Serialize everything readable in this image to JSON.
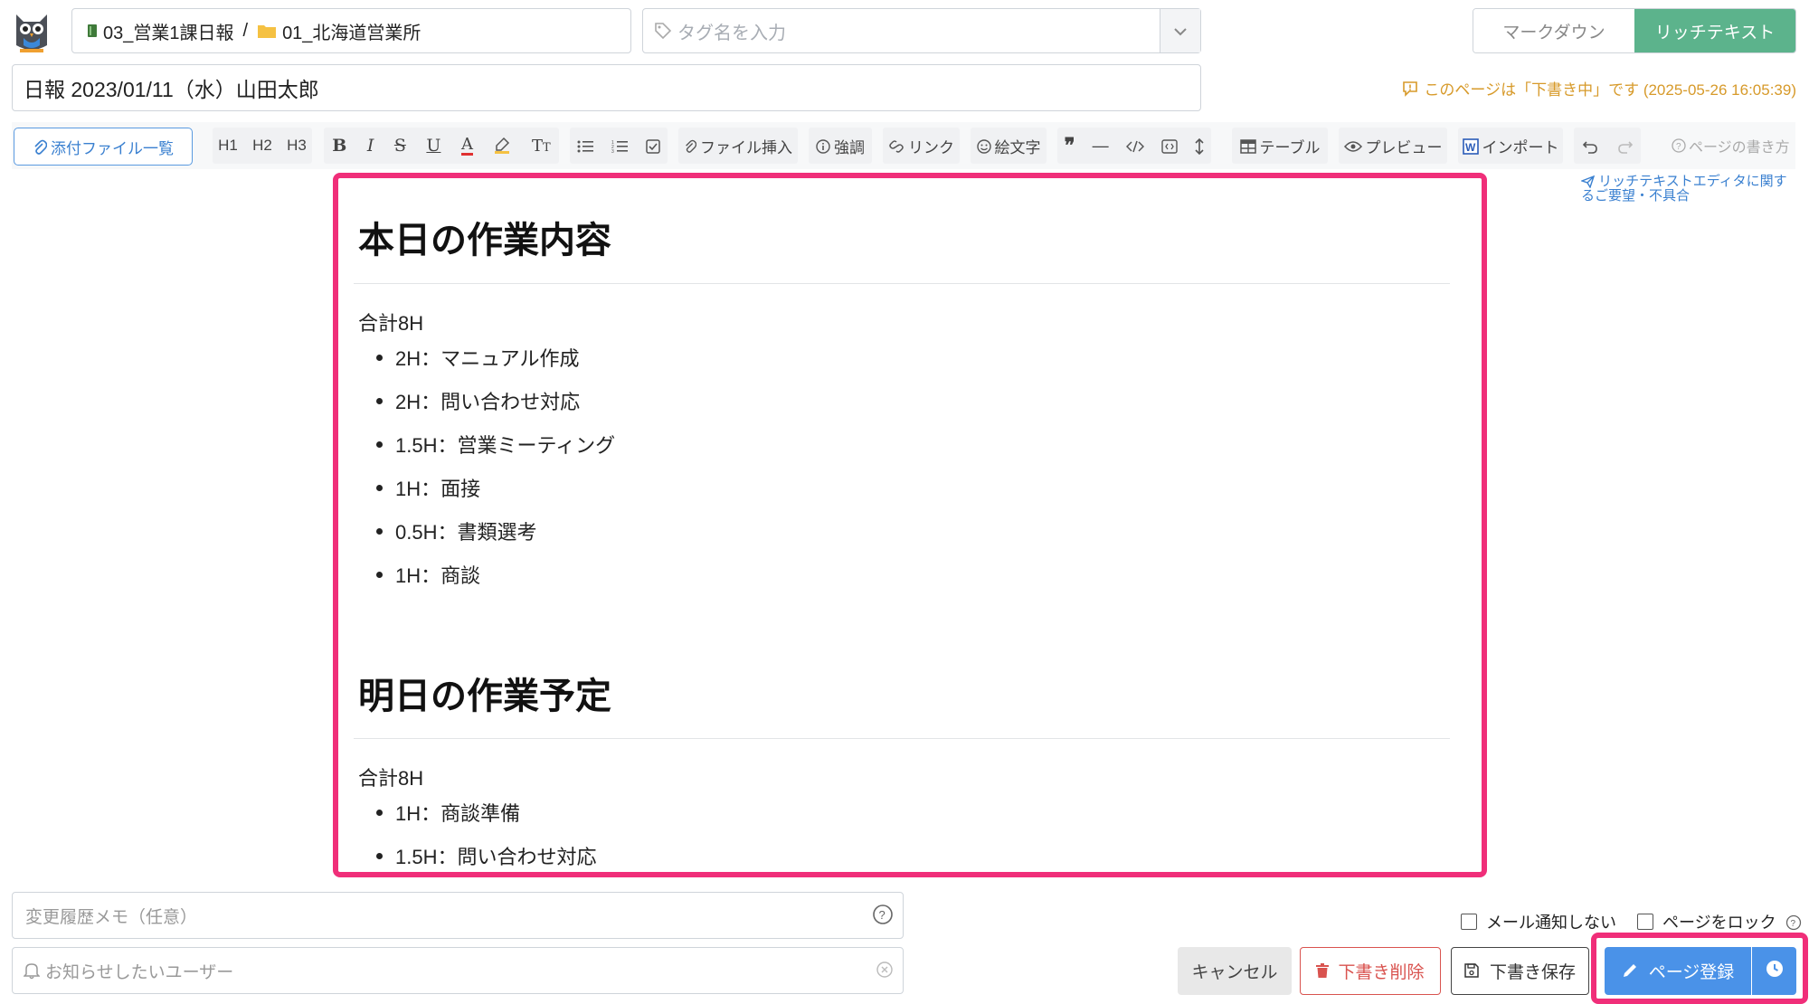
{
  "header": {
    "breadcrumb": {
      "notebook": "03_営業1課日報",
      "separator": "/",
      "folder": "01_北海道営業所"
    },
    "tag_placeholder": "タグ名を入力",
    "mode_markdown": "マークダウン",
    "mode_richtext": "リッチテキスト"
  },
  "title": "日報 2023/01/11（水）山田太郎",
  "draft_status": "このページは「下書き中」です (2025-05-26 16:05:39)",
  "toolbar": {
    "attachments": "添付ファイル一覧",
    "h1": "H1",
    "h2": "H2",
    "h3": "H3",
    "insert_file": "ファイル挿入",
    "emphasis": "強調",
    "link": "リンク",
    "emoji": "絵文字",
    "table": "テーブル",
    "preview": "プレビュー",
    "import": "インポート",
    "page_help": "ページの書き方",
    "feedback": "リッチテキストエディタに関するご要望・不具合"
  },
  "content": {
    "section1": {
      "heading": "本日の作業内容",
      "total": "合計8H",
      "items": [
        "2H：マニュアル作成",
        "2H：問い合わせ対応",
        "1.5H：営業ミーティング",
        "1H：面接",
        "0.5H：書類選考",
        "1H：商談"
      ]
    },
    "section2": {
      "heading": "明日の作業予定",
      "total": "合計8H",
      "items": [
        "1H：商談準備",
        "1.5H：問い合わせ対応"
      ]
    }
  },
  "footer": {
    "memo_placeholder": "変更履歴メモ（任意）",
    "notify_placeholder": "お知らせしたいユーザー",
    "no_mail": "メール通知しない",
    "lock_page": "ページをロック",
    "cancel": "キャンセル",
    "delete_draft": "下書き削除",
    "save_draft": "下書き保存",
    "register": "ページ登録"
  },
  "colors": {
    "accent_pink": "#f02e79",
    "primary_blue": "#4a92e8",
    "richtext_green": "#5cb38c",
    "draft_orange": "#d79a2a"
  }
}
